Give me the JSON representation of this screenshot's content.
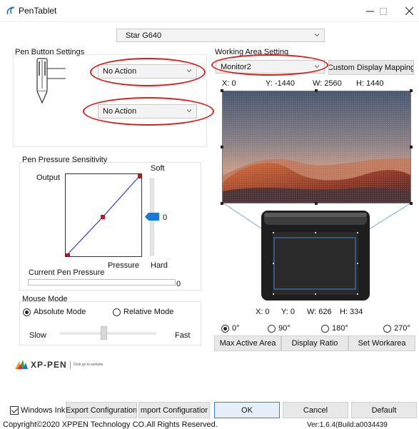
{
  "window": {
    "title": "PenTablet"
  },
  "device": {
    "selected": "Star G640"
  },
  "pen_buttons": {
    "label": "Pen Button Settings",
    "button1": "No Action",
    "button2": "No Action"
  },
  "pressure": {
    "label": "Pen Pressure Sensitivity",
    "output": "Output",
    "pressure": "Pressure",
    "soft": "Soft",
    "hard": "Hard",
    "slider_value": "0",
    "current_label": "Current Pen Pressure",
    "current_value": "0",
    "current_level": 0
  },
  "mouse_mode": {
    "label": "Mouse Mode",
    "absolute": "Absolute Mode",
    "relative": "Relative Mode",
    "selected": "absolute",
    "slow": "Slow",
    "fast": "Fast"
  },
  "working_area": {
    "label": "Working Area Setting",
    "monitor": "Monitor2",
    "custom_mapping": "Custom Display Mapping",
    "x": "X: 0",
    "y": "Y: -1440",
    "w": "W: 2560",
    "h": "H: 1440"
  },
  "tablet_area": {
    "x": "X: 0",
    "y": "Y: 0",
    "w": "W: 626",
    "h": "H: 334"
  },
  "rotation": {
    "selected": "0",
    "r0": "0°",
    "r90": "90°",
    "r180": "180°",
    "r270": "270°"
  },
  "area_buttons": {
    "max": "Max Active Area",
    "ratio": "Display Ratio",
    "set": "Set Workarea"
  },
  "logo": {
    "brand": "XP-PEN",
    "tagline": "Click go to website"
  },
  "bottom": {
    "windows_ink": "Windows Ink",
    "export": "Export Configuration",
    "import": "mport Configuratior",
    "ok": "OK",
    "cancel": "Cancel",
    "default": "Default"
  },
  "footer": {
    "copyright": "Copyright©2020 XPPEN Technology CO.All Rights Reserved.",
    "version": "Ver:1.6.4(Build:a0034439"
  }
}
